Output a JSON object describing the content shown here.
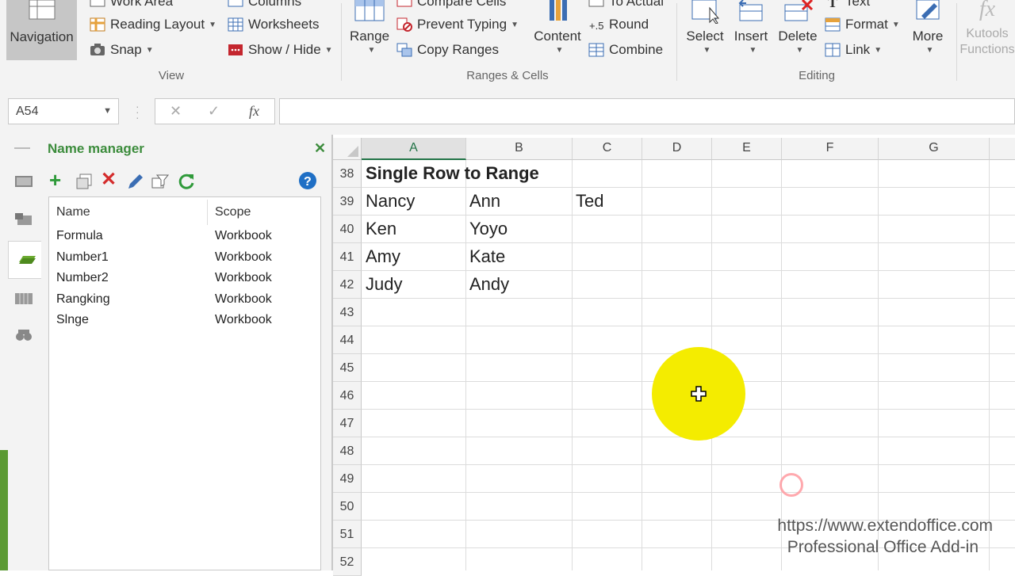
{
  "ribbon": {
    "navigation_label": "Navigation",
    "view_items": [
      {
        "label": "Work Area",
        "icon": "work-area-icon"
      },
      {
        "label": "Reading Layout",
        "icon": "reading-layout-icon"
      },
      {
        "label": "Snap",
        "icon": "camera-icon"
      }
    ],
    "view_items2": [
      {
        "label": "Columns",
        "icon": "columns-icon"
      },
      {
        "label": "Worksheets",
        "icon": "worksheets-icon"
      },
      {
        "label": "Show / Hide",
        "icon": "show-hide-icon"
      }
    ],
    "view_group": "View",
    "range_label": "Range",
    "ranges_items": [
      {
        "label": "Compare Cells",
        "icon": "compare-cells-icon"
      },
      {
        "label": "Prevent Typing",
        "icon": "prevent-typing-icon"
      },
      {
        "label": "Copy Ranges",
        "icon": "copy-ranges-icon"
      }
    ],
    "content_label": "Content",
    "ranges_items2": [
      {
        "label": "To Actual",
        "icon": "to-actual-icon"
      },
      {
        "label": "Round",
        "icon": "round-icon"
      },
      {
        "label": "Combine",
        "icon": "combine-icon"
      }
    ],
    "ranges_group": "Ranges & Cells",
    "select_label": "Select",
    "insert_label": "Insert",
    "delete_label": "Delete",
    "editing_items": [
      {
        "label": "Text",
        "icon": "text-icon"
      },
      {
        "label": "Format",
        "icon": "format-icon"
      },
      {
        "label": "Link",
        "icon": "link-icon"
      }
    ],
    "more_label": "More",
    "editing_group": "Editing",
    "kutools_label": "Kutools",
    "functions_label": "Functions",
    "fx_symbol": "fx"
  },
  "formula_bar": {
    "name_box": "A54",
    "fx_label": "fx",
    "cancel_symbol": "✕",
    "enter_symbol": "✓",
    "formula": ""
  },
  "name_manager": {
    "title": "Name manager",
    "close_symbol": "✕",
    "toolbar": [
      "add-icon",
      "copy-icon",
      "delete-icon",
      "edit-icon",
      "filter-icon",
      "refresh-icon",
      "help-icon"
    ],
    "columns": [
      "Name",
      "Scope"
    ],
    "rows": [
      {
        "name": "Formula",
        "scope": "Workbook"
      },
      {
        "name": "Number1",
        "scope": "Workbook"
      },
      {
        "name": "Number2",
        "scope": "Workbook"
      },
      {
        "name": "Rangking",
        "scope": "Workbook"
      },
      {
        "name": "Slnge",
        "scope": "Workbook"
      }
    ]
  },
  "sheet": {
    "columns": [
      "A",
      "B",
      "C",
      "D",
      "E",
      "F",
      "G"
    ],
    "selected_column": "A",
    "rows": [
      "38",
      "39",
      "40",
      "41",
      "42",
      "43",
      "44",
      "45",
      "46",
      "47",
      "48",
      "49",
      "50",
      "51",
      "52"
    ],
    "cells": {
      "A38": "Single Row to Range",
      "A39": "Nancy",
      "B39": "Ann",
      "C39": "Ted",
      "A40": "Ken",
      "B40": "Yoyo",
      "A41": "Amy",
      "B41": "Kate",
      "A42": "Judy",
      "B42": "Andy"
    }
  },
  "watermark": {
    "url": "https://www.extendoffice.com",
    "tagline": "Professional Office Add-in"
  },
  "colors": {
    "accent_green": "#217346",
    "pane_title": "#3c8c3c",
    "highlight": "#f4ec00"
  }
}
